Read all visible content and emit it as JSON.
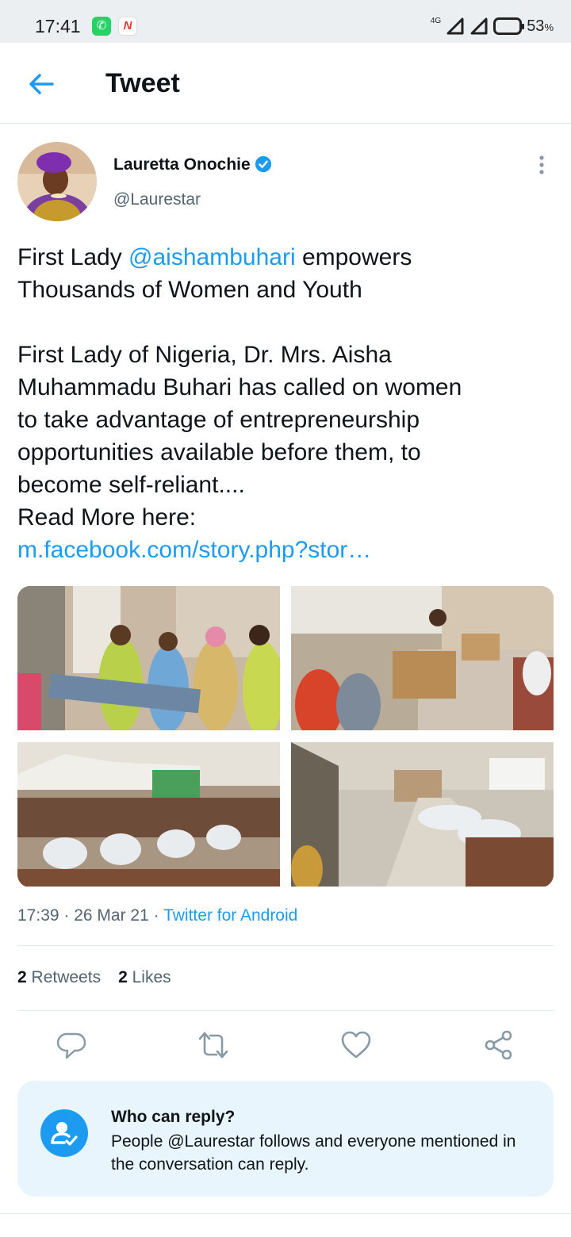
{
  "status_bar": {
    "time": "17:41",
    "network": "4G",
    "battery_percent": "53",
    "battery_unit": "%",
    "icons": [
      "whatsapp-icon",
      "news-icon",
      "signal-icon",
      "signal-icon",
      "battery-icon"
    ]
  },
  "header": {
    "title": "Tweet",
    "back_icon": "back-arrow-icon"
  },
  "tweet": {
    "author_name": "Lauretta Onochie",
    "author_handle": "@Laurestar",
    "verified": true,
    "text_line1_prefix": "First Lady ",
    "mention": "@aishambuhari",
    "text_line1_suffix": " empowers",
    "text_line2": "Thousands of Women and Youth",
    "text_line3": "First Lady of Nigeria, Dr. Mrs. Aisha",
    "text_line4": "Muhammadu Buhari has called on women",
    "text_line5": "to take advantage of entrepreneurship",
    "text_line6": "opportunities available before them, to",
    "text_line7": "become self-reliant....",
    "text_line8": "Read More here:",
    "link": "m.facebook.com/story.php?stor…",
    "photo_count": 4,
    "time": "17:39",
    "separator": " · ",
    "date": "26 Mar 21",
    "source": "Twitter for Android"
  },
  "stats": {
    "retweets_count": "2",
    "retweets_label": "Retweets",
    "likes_count": "2",
    "likes_label": "Likes"
  },
  "actions": [
    "reply-icon",
    "retweet-icon",
    "like-icon",
    "share-icon"
  ],
  "reply_settings": {
    "title": "Who can reply?",
    "description": "People @Laurestar follows and everyone mentioned in the conversation can reply."
  },
  "colors": {
    "accent": "#1d9bf0",
    "text": "#0f1419",
    "secondary": "#536471",
    "reply_box_bg": "#e8f5fd"
  }
}
